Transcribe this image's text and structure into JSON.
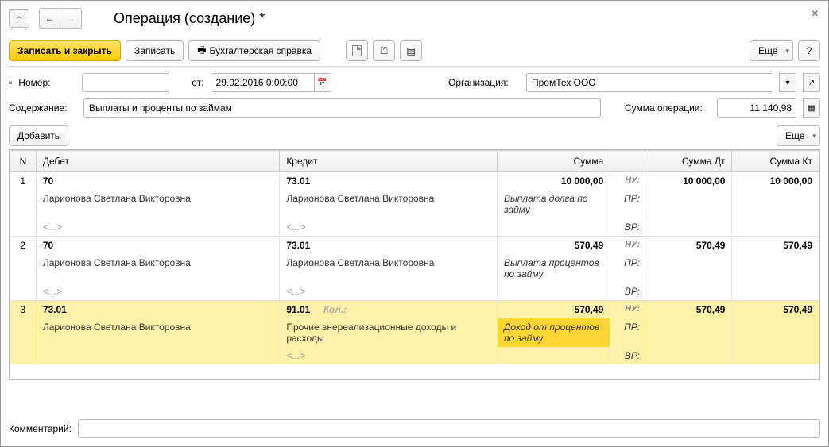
{
  "title": "Операция (создание) *",
  "toolbar": {
    "save_close": "Записать и закрыть",
    "save": "Записать",
    "print": "Бухгалтерская справка",
    "more": "Еще"
  },
  "form": {
    "number_label": "Номер:",
    "from_label": "от:",
    "date": "29.02.2016  0:00:00",
    "org_label": "Организация:",
    "org": "ПромТех ООО",
    "content_label": "Содержание:",
    "content": "Выплаты и проценты по займам",
    "sum_label": "Сумма операции:",
    "sum": "11 140,98"
  },
  "table_toolbar": {
    "add": "Добавить",
    "more": "Еще"
  },
  "columns": {
    "n": "N",
    "debit": "Дебет",
    "credit": "Кредит",
    "sum": "Сумма",
    "sdt": "Сумма Дт",
    "skt": "Сумма Кт"
  },
  "tags": {
    "nu": "НУ:",
    "pr": "ПР:",
    "vr": "ВР:"
  },
  "ellipsis": "<...>",
  "kol": "Кол.:",
  "rows": [
    {
      "n": "1",
      "debit_acc": "70",
      "credit_acc": "73.01",
      "sum": "10 000,00",
      "sdt": "10 000,00",
      "skt": "10 000,00",
      "debit_sub": "Ларионова Светлана Викторовна",
      "credit_sub": "Ларионова Светлана Викторовна",
      "desc": "Выплата долга по займу"
    },
    {
      "n": "2",
      "debit_acc": "70",
      "credit_acc": "73.01",
      "sum": "570,49",
      "sdt": "570,49",
      "skt": "570,49",
      "debit_sub": "Ларионова Светлана Викторовна",
      "credit_sub": "Ларионова Светлана Викторовна",
      "desc": "Выплата процентов по займу"
    },
    {
      "n": "3",
      "debit_acc": "73.01",
      "credit_acc": "91.01",
      "sum": "570,49",
      "sdt": "570,49",
      "skt": "570,49",
      "debit_sub": "Ларионова Светлана Викторовна",
      "credit_sub": "Прочие внереализационные доходы и расходы",
      "desc": "Доход от процентов по займу",
      "selected": true
    }
  ],
  "comment_label": "Комментарий:"
}
